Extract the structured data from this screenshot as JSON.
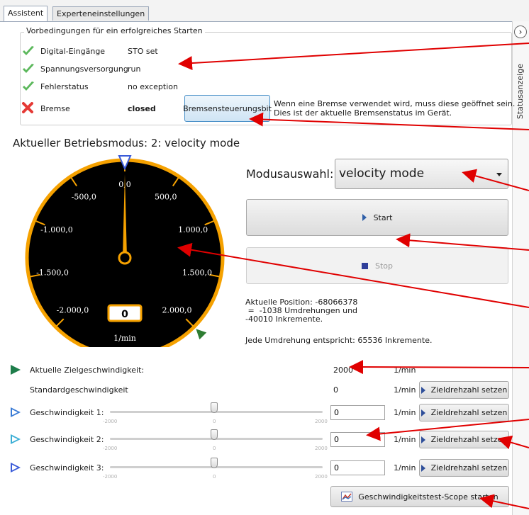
{
  "tabs": [
    {
      "label": "Assistent"
    },
    {
      "label": "Experteneinstellungen"
    }
  ],
  "sidebar": {
    "label": "Statusanzeige",
    "button_glyph": "›"
  },
  "preconditions": {
    "title": "Vorbedingungen für ein erfolgreiches Starten",
    "rows": [
      {
        "label": "Digital-Eingänge",
        "value": "STO set",
        "status": "ok",
        "icon": "check-icon"
      },
      {
        "label": "Spannungsversorgung",
        "value": "run",
        "status": "ok",
        "icon": "check-icon"
      },
      {
        "label": "Fehlerstatus",
        "value": "no exception",
        "status": "ok",
        "icon": "check-icon"
      },
      {
        "label": "Bremse",
        "value": "closed",
        "status": "error",
        "icon": "cross-icon"
      }
    ],
    "brake_button": "Bremsensteuerungsbit",
    "brake_hint_line1": "Wenn eine Bremse verwendet wird, muss diese geöffnet sein.",
    "brake_hint_line2": "Dies ist der aktuelle Bremsenstatus im Gerät."
  },
  "mode_heading": "Aktueller Betriebsmodus: 2: velocity mode",
  "gauge": {
    "labels": [
      "0,0",
      "500,0",
      "1.000,0",
      "1.500,0",
      "2.000,0",
      "-500,0",
      "-1.000,0",
      "-1.500,0",
      "-2.000,0"
    ],
    "value": "0",
    "unit": "1/min",
    "current_value_rpm": 0,
    "target_value_rpm": 2000,
    "colors": {
      "rim": "#f5a100",
      "face": "#000000",
      "needle": "#f5a100",
      "target_marker": "#2e7d32",
      "setpoint_marker": "#3a5bd9"
    }
  },
  "mode_select": {
    "label": "Modusauswahl:",
    "value": "velocity mode"
  },
  "start_button": "Start",
  "stop_button": "Stop",
  "position_info": {
    "line1": "Aktuelle Position: -68066378",
    "line2": " =  -1038 Umdrehungen und",
    "line3": "-40010 Inkremente.",
    "line4": "Jede Umdrehung entspricht: 65536 Inkremente."
  },
  "rows": {
    "target_speed": {
      "label": "Aktuelle Zielgeschwindigkeit:",
      "value": "2000",
      "unit": "1/min"
    },
    "standard_speed": {
      "label": "Standardgeschwindigkeit",
      "value": "0",
      "unit": "1/min",
      "button": "Zieldrehzahl setzen"
    },
    "speed1": {
      "label": "Geschwindigkeit 1:",
      "value": "0",
      "unit": "1/min",
      "button": "Zieldrehzahl setzen"
    },
    "speed2": {
      "label": "Geschwindigkeit 2:",
      "value": "0",
      "unit": "1/min",
      "button": "Zieldrehzahl setzen"
    },
    "speed3": {
      "label": "Geschwindigkeit 3:",
      "value": "0",
      "unit": "1/min",
      "button": "Zieldrehzahl setzen"
    }
  },
  "slider_ticks": {
    "min": "-2000",
    "mid": "0",
    "max": "2000"
  },
  "slider_value": 0,
  "scope_button": "Geschwindigkeitstest-Scope starten",
  "colors": {
    "annotation_arrow": "#e00000",
    "check": "#4caf50",
    "cross": "#e53935",
    "row_marker_dark": "#1e7d4a",
    "row_marker_light": "#3a7bd5"
  }
}
